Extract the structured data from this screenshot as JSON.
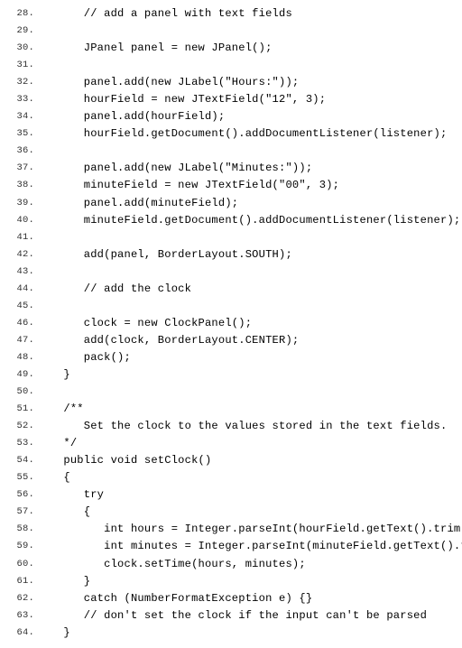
{
  "lines": [
    {
      "n": "28.",
      "t": "      // add a panel with text fields"
    },
    {
      "n": "29.",
      "t": ""
    },
    {
      "n": "30.",
      "t": "      JPanel panel = new JPanel();"
    },
    {
      "n": "31.",
      "t": ""
    },
    {
      "n": "32.",
      "t": "      panel.add(new JLabel(\"Hours:\"));"
    },
    {
      "n": "33.",
      "t": "      hourField = new JTextField(\"12\", 3);"
    },
    {
      "n": "34.",
      "t": "      panel.add(hourField);"
    },
    {
      "n": "35.",
      "t": "      hourField.getDocument().addDocumentListener(listener);"
    },
    {
      "n": "36.",
      "t": ""
    },
    {
      "n": "37.",
      "t": "      panel.add(new JLabel(\"Minutes:\"));"
    },
    {
      "n": "38.",
      "t": "      minuteField = new JTextField(\"00\", 3);"
    },
    {
      "n": "39.",
      "t": "      panel.add(minuteField);"
    },
    {
      "n": "40.",
      "t": "      minuteField.getDocument().addDocumentListener(listener);"
    },
    {
      "n": "41.",
      "t": ""
    },
    {
      "n": "42.",
      "t": "      add(panel, BorderLayout.SOUTH);"
    },
    {
      "n": "43.",
      "t": ""
    },
    {
      "n": "44.",
      "t": "      // add the clock"
    },
    {
      "n": "45.",
      "t": ""
    },
    {
      "n": "46.",
      "t": "      clock = new ClockPanel();"
    },
    {
      "n": "47.",
      "t": "      add(clock, BorderLayout.CENTER);"
    },
    {
      "n": "48.",
      "t": "      pack();"
    },
    {
      "n": "49.",
      "t": "   }"
    },
    {
      "n": "50.",
      "t": ""
    },
    {
      "n": "51.",
      "t": "   /**"
    },
    {
      "n": "52.",
      "t": "      Set the clock to the values stored in the text fields."
    },
    {
      "n": "53.",
      "t": "   */"
    },
    {
      "n": "54.",
      "t": "   public void setClock()"
    },
    {
      "n": "55.",
      "t": "   {"
    },
    {
      "n": "56.",
      "t": "      try"
    },
    {
      "n": "57.",
      "t": "      {"
    },
    {
      "n": "58.",
      "t": "         int hours = Integer.parseInt(hourField.getText().trim());"
    },
    {
      "n": "59.",
      "t": "         int minutes = Integer.parseInt(minuteField.getText().trim());"
    },
    {
      "n": "60.",
      "t": "         clock.setTime(hours, minutes);"
    },
    {
      "n": "61.",
      "t": "      }"
    },
    {
      "n": "62.",
      "t": "      catch (NumberFormatException e) {}"
    },
    {
      "n": "63.",
      "t": "      // don't set the clock if the input can't be parsed"
    },
    {
      "n": "64.",
      "t": "   }"
    }
  ]
}
